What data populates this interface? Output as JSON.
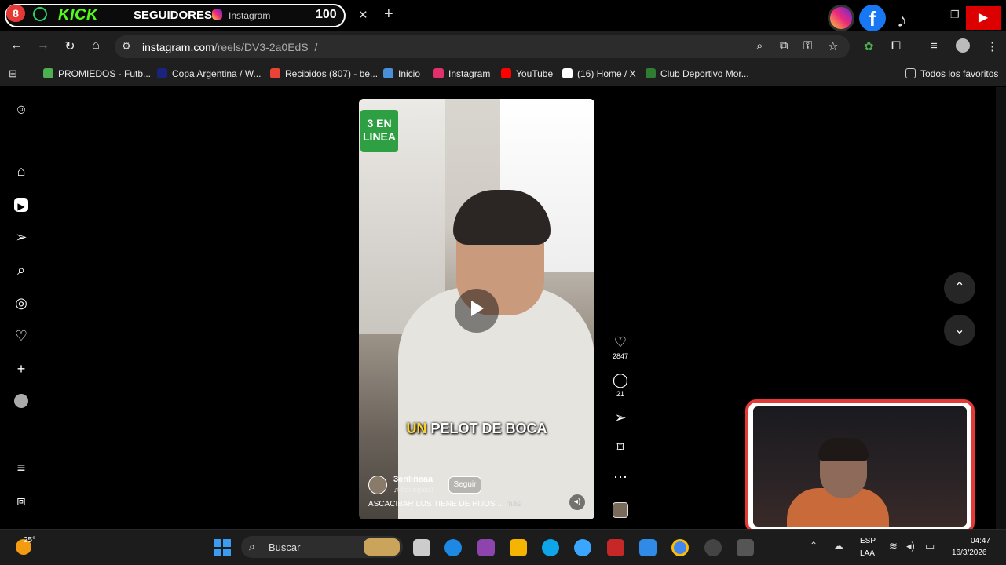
{
  "tab": {
    "badge": "8",
    "kick_label": "KICK",
    "seguidores_label": "SEGUIDORES",
    "title": "Instagram",
    "count": "100",
    "close": "✕",
    "new_tab": "+"
  },
  "navbar": {
    "url_host": "instagram.com",
    "url_path": "/reels/DV3-2a0EdS_/"
  },
  "bookmarks": [
    {
      "label": "PROMIEDOS - Futb...",
      "color": "#4caf50"
    },
    {
      "label": "Copa Argentina / W...",
      "color": "#1a237e"
    },
    {
      "label": "Recibidos (807) - be...",
      "color": "#ea4335"
    },
    {
      "label": "Inicio",
      "color": "#4a90d9"
    },
    {
      "label": "Instagram",
      "color": "#e1306c"
    },
    {
      "label": "YouTube",
      "color": "#ff0000"
    },
    {
      "label": "(16) Home / X",
      "color": "#ffffff"
    },
    {
      "label": "Club Deportivo Mor...",
      "color": "#2e7d32"
    }
  ],
  "bookmarks_all": "Todos los favoritos",
  "reel": {
    "logo_line1": "3 EN",
    "logo_line2": "LINEA",
    "caption_highlight": "UN",
    "caption_rest": " PELOT DE BOCA",
    "author": "3enlineaa",
    "author_sub": "♫ franeguia1",
    "follow": "Seguir",
    "description": "ASCACIBAR LOS TIENE DE HIJOS ...",
    "description_more": " más",
    "likes": "2847",
    "comments": "21"
  },
  "taskbar": {
    "temperature": "25°",
    "search": "Buscar",
    "lang1": "ESP",
    "lang2": "LAA",
    "time": "04:47",
    "date": "16/3/2026"
  }
}
